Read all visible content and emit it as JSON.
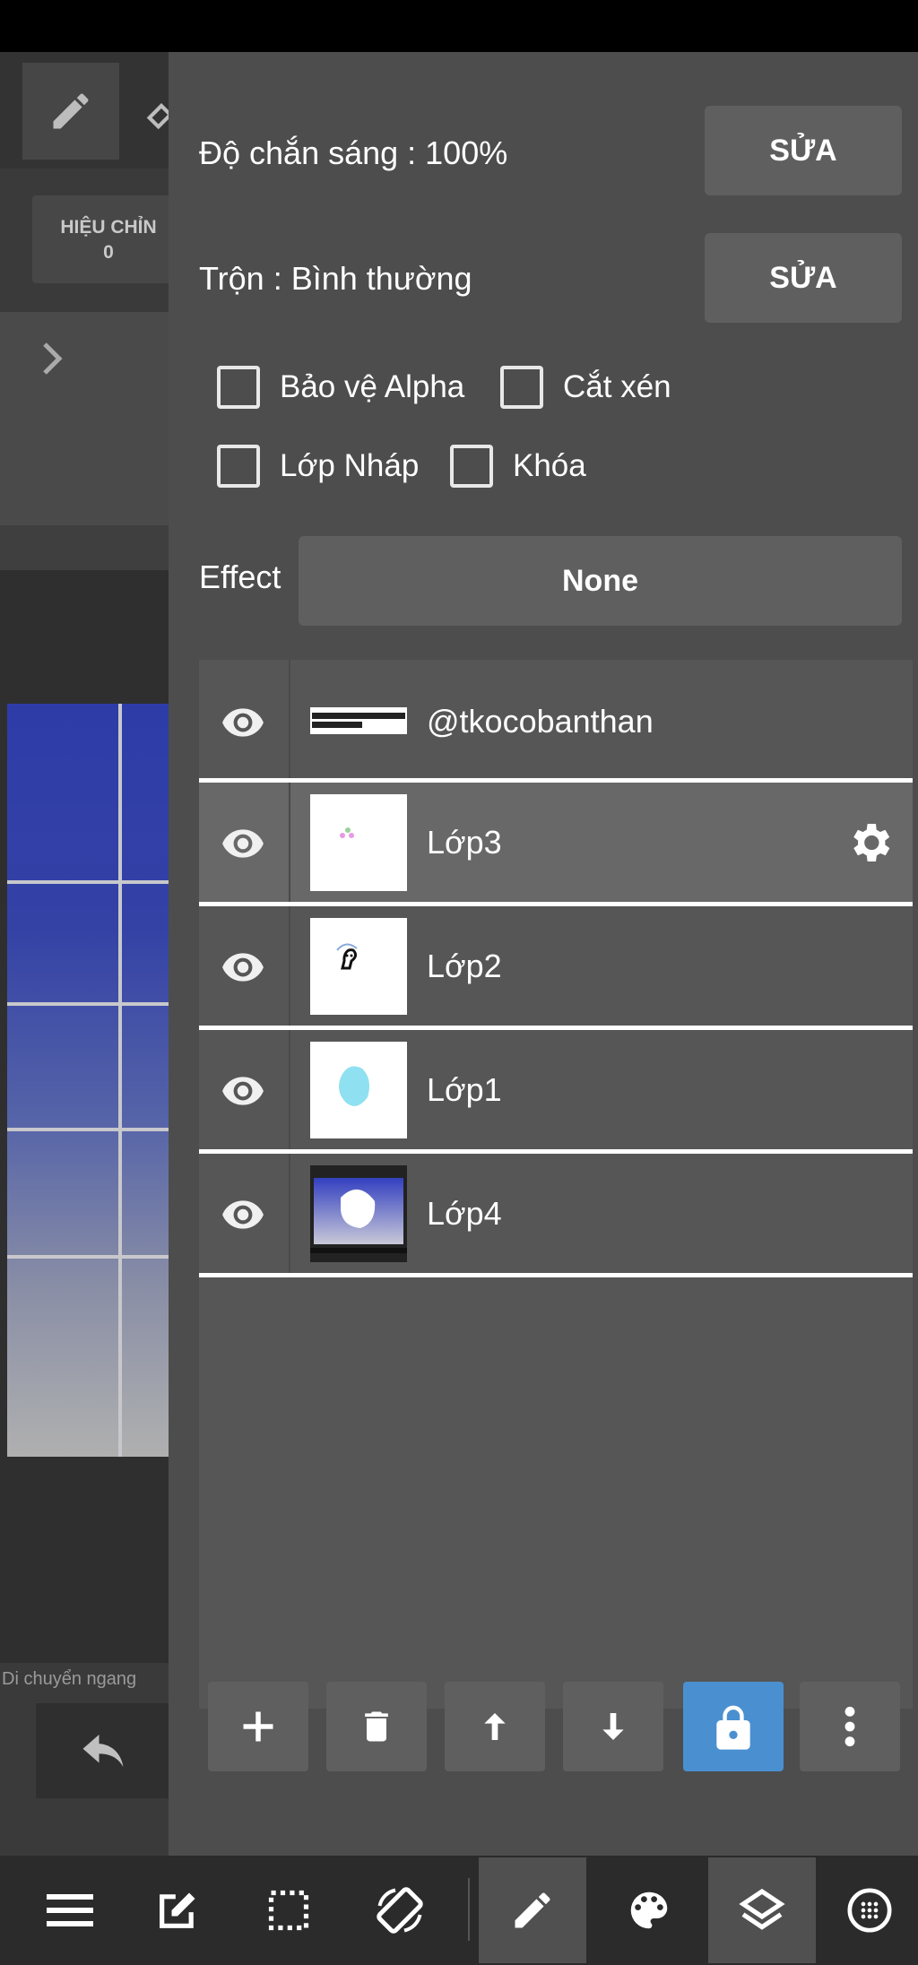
{
  "background": {
    "adjust_label": "HIỆU CHỈN",
    "adjust_value": "0",
    "move_text": "Di chuyển ngang"
  },
  "panel": {
    "opacity_label": "Độ chắn sáng : 100%",
    "opacity_edit": "SỬA",
    "blend_label": "Trộn : Bình thường",
    "blend_edit": "SỬA",
    "checkboxes": {
      "alpha": "Bảo vệ Alpha",
      "clip": "Cắt xén",
      "draft": "Lớp Nháp",
      "lock": "Khóa"
    },
    "effect_label": "Effect",
    "effect_value": "None"
  },
  "layers": [
    {
      "name": "@tkocobanthan",
      "thumb_text": "@TKOCOBANTHAN #HOIDAP247",
      "selected": false
    },
    {
      "name": "Lớp3",
      "selected": true
    },
    {
      "name": "Lớp2",
      "selected": false
    },
    {
      "name": "Lớp1",
      "selected": false
    },
    {
      "name": "Lớp4",
      "selected": false
    }
  ],
  "colors": {
    "panel_bg": "#4d4d4d",
    "button_bg": "#5f5f5f",
    "selected_row": "#686868",
    "accent_lock": "#4a90d0"
  },
  "actions": [
    "add-icon",
    "delete-icon",
    "move-up-icon",
    "move-down-icon",
    "lock-icon",
    "more-vert-icon"
  ],
  "nav": [
    "menu-icon",
    "edit-icon",
    "selection-icon",
    "rotate-icon",
    "brush-icon",
    "palette-icon",
    "layers-icon",
    "grid-icon"
  ]
}
